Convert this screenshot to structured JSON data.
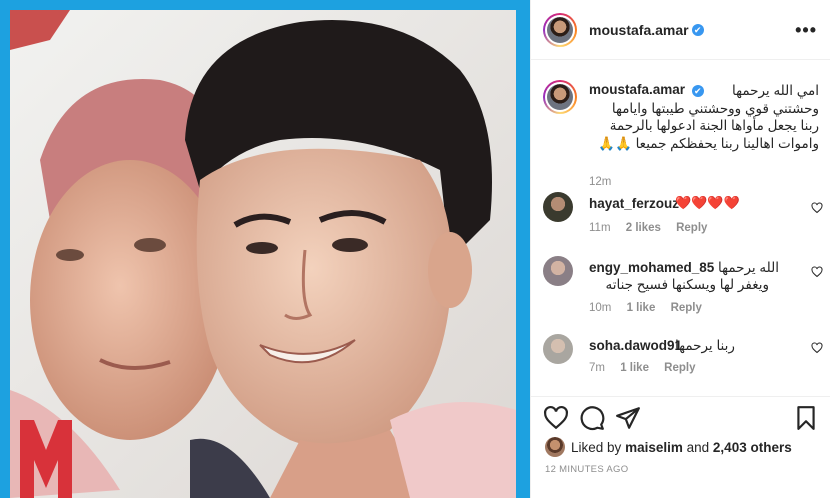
{
  "post": {
    "author": "moustafa.amar",
    "verified_mark": "✔",
    "more_label": "•••",
    "caption_user": "moustafa.amar",
    "caption_lines": [
      "امي الله يرحمها",
      "وحشتني قوي ووحشتني طيبتها وايامها",
      "ربنا يجعل مأواها الجنة ادعولها بالرحمة",
      "واموات اهالينا ربنا يحفظكم جميعا 🙏🙏"
    ],
    "caption_time": "12m"
  },
  "comments": [
    {
      "user": "hayat_ferzouz",
      "text": "❤️❤️❤️❤️",
      "time": "11m",
      "likes": "2 likes",
      "reply": "Reply",
      "avatar_color": "#3a3a2e"
    },
    {
      "user": "engy_mohamed_85",
      "text_lines": [
        "الله يرحمها",
        "ويغفر لها ويسكنها فسيح جناته"
      ],
      "time": "10m",
      "likes": "1 like",
      "reply": "Reply",
      "avatar_color": "#8a7f86"
    },
    {
      "user": "soha.dawod91",
      "text": "ربنا يرحمها",
      "time": "7m",
      "likes": "1 like",
      "reply": "Reply",
      "avatar_color": "#a9a6a0"
    }
  ],
  "icons": {
    "like": "heart-icon",
    "comment": "comment-icon",
    "share": "paper-plane-icon",
    "save": "bookmark-icon",
    "comment_like": "small-heart-icon"
  },
  "likes": {
    "prefix": "Liked by",
    "user": "maiselim",
    "middle": "and",
    "count": "2,403 others"
  },
  "post_time": "12 MINUTES AGO",
  "colors": {
    "media_border": "#1da1e0",
    "verified": "#3897f0",
    "muted_text": "#8e8e8e",
    "heart_red": "#ed2b3a"
  }
}
